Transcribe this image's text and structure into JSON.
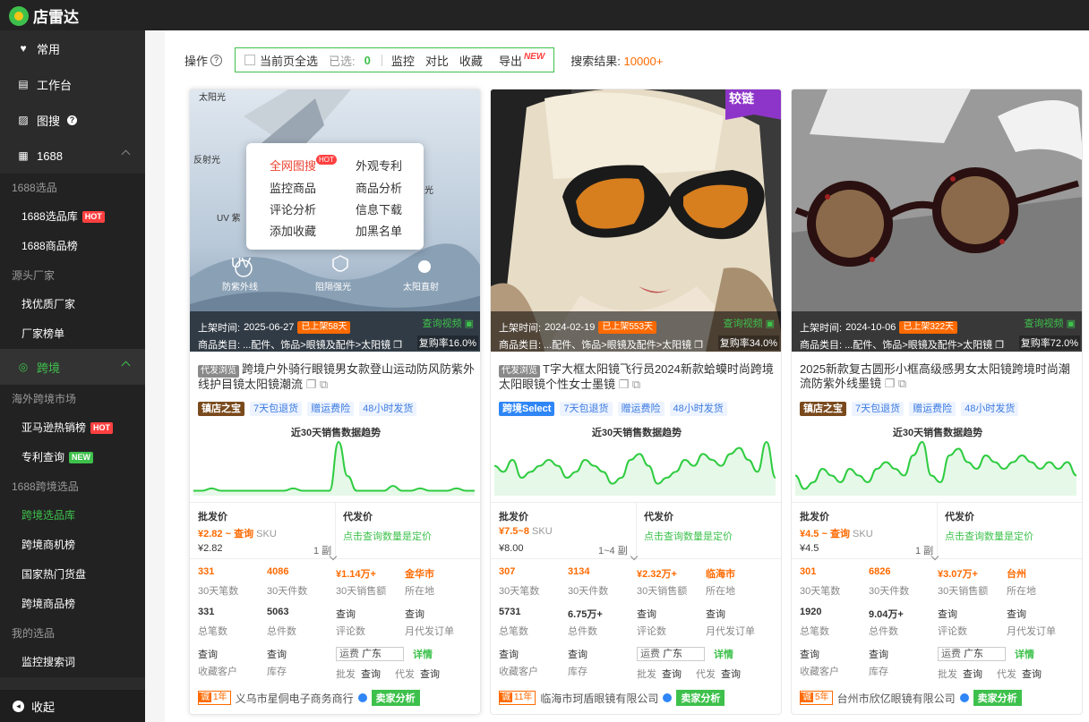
{
  "app": {
    "name": "店雷达"
  },
  "sidebar": {
    "items": [
      {
        "label": "常用"
      },
      {
        "label": "工作台"
      },
      {
        "label": "图搜"
      }
    ],
    "sec1688": "1688",
    "g1": "1688选品",
    "i1": "1688选品库",
    "i2": "1688商品榜",
    "g2": "源头厂家",
    "i3": "找优质厂家",
    "i4": "厂家榜单",
    "cross": "跨境",
    "g3": "海外跨境市场",
    "i5": "亚马逊热销榜",
    "i6": "专利查询",
    "g4": "1688跨境选品",
    "i7": "跨境选品库",
    "i8": "跨境商机榜",
    "i9": "国家热门货盘",
    "i10": "跨境商品榜",
    "g5": "我的选品",
    "i11": "监控搜索词",
    "collapse": "收起",
    "hot": "HOT",
    "new": "NEW"
  },
  "toolbar": {
    "op": "操作",
    "select_all": "当前页全选",
    "selected": "已选:",
    "count": "0",
    "monitor": "监控",
    "compare": "对比",
    "fav": "收藏",
    "export": "导出",
    "newtag": "NEW",
    "result_label": "搜索结果:",
    "result_value": "10000+"
  },
  "menu": {
    "a": "全网图搜",
    "hot": "HOT",
    "b": "外观专利",
    "c": "监控商品",
    "d": "商品分析",
    "e": "评论分析",
    "f": "信息下载",
    "g": "添加收藏",
    "h": "加黑名单"
  },
  "common": {
    "up_label": "上架时间:",
    "cat_label": "商品类目:",
    "cat_value": "...配件、饰品>眼镜及配件>太阳镜",
    "video": "查询视频",
    "trend": "近30天销售数据趋势",
    "wholesale": "批发价",
    "sku": "SKU",
    "dropship": "代发价",
    "dropship_link": "点击查询数量是定价",
    "l_30orders": "30天笔数",
    "l_30pieces": "30天件数",
    "l_30sales": "30天销售额",
    "l_loc": "所在地",
    "l_total_orders": "总笔数",
    "l_total_pieces": "总件数",
    "l_reviews": "评论数",
    "l_monthly": "月代发订单",
    "query": "查询",
    "l_fav_customers": "收藏客户",
    "l_stock": "库存",
    "freight": "运费",
    "freight_val": "广东",
    "detail": "详情",
    "pifa": "批发",
    "daifa": "代发",
    "seller_btn": "卖家分析",
    "daifa_tag": "代发浏览"
  },
  "cards": [
    {
      "date": "2025-06-27",
      "up_tag": "已上架58天",
      "repo": "复购率16.0%",
      "title": "跨境户外骑行眼镜男女款登山运动防风防紫外线护目镜太阳镜潮流",
      "has_dtag": true,
      "badge": "镇店之宝",
      "t1": "7天包退货",
      "t2": "赠运费险",
      "t3": "48小时发货",
      "price": "¥2.82 ~ 查询",
      "price2": "¥2.82",
      "moq": "1 副",
      "o30": "331",
      "p30": "4086",
      "s30": "¥1.14万+",
      "loc": "金华市",
      "to": "331",
      "tp": "5063",
      "years": "1年",
      "seller": "义乌市星侗电子商务商行",
      "img_labels": [
        "太阳光",
        "反射光",
        "UV 紫",
        "UV",
        "防紫外线",
        "阻隔强光",
        "太阳直射",
        "光"
      ]
    },
    {
      "date": "2024-02-19",
      "up_tag": "已上架553天",
      "repo": "复购率34.0%",
      "title": "T字大框太阳镜飞行员2024新款蛤蟆时尚跨境太阳眼镜个性女士墨镜",
      "has_dtag": true,
      "badge": "跨境Select",
      "t1": "7天包退货",
      "t2": "赠运费险",
      "t3": "48小时发货",
      "price": "¥7.5~8",
      "price2": "¥8.00",
      "moq": "1~4 副",
      "o30": "307",
      "p30": "3134",
      "s30": "¥2.32万+",
      "loc": "临海市",
      "to": "5731",
      "tp": "6.75万+",
      "years": "11年",
      "seller": "临海市珂盾眼镜有限公司",
      "corner": "较链"
    },
    {
      "date": "2024-10-06",
      "up_tag": "已上架322天",
      "repo": "复购率72.0%",
      "title": "2025新款复古圆形小框高级感男女太阳镜跨境时尚潮流防紫外线墨镜",
      "has_dtag": false,
      "badge": "镇店之宝",
      "t1": "7天包退货",
      "t2": "赠运费险",
      "t3": "48小时发货",
      "price": "¥4.5 ~ 查询",
      "price2": "¥4.5",
      "moq": "1 副",
      "o30": "301",
      "p30": "6826",
      "s30": "¥3.07万+",
      "loc": "台州",
      "to": "1920",
      "tp": "9.04万+",
      "years": "5年",
      "seller": "台州市欣亿眼镜有限公司"
    }
  ],
  "chart_data": [
    {
      "type": "area",
      "title": "近30天销售数据趋势",
      "values": [
        1,
        1,
        1.5,
        1,
        1,
        1,
        1,
        1,
        1,
        1,
        1,
        1.5,
        1,
        1,
        1,
        1,
        11,
        4,
        1,
        1,
        1,
        1,
        2,
        1,
        1,
        1.5,
        1,
        1,
        1,
        1.5,
        1,
        1
      ]
    },
    {
      "type": "area",
      "title": "近30天销售数据趋势",
      "values": [
        5,
        4,
        6,
        3,
        4,
        5,
        6,
        5,
        3,
        4,
        6,
        5,
        4,
        2,
        3,
        6,
        7,
        5,
        2,
        3,
        4,
        6,
        5,
        7,
        6,
        5,
        7,
        8,
        6,
        4,
        9,
        3
      ]
    },
    {
      "type": "area",
      "title": "近30天销售数据趋势",
      "values": [
        3,
        1,
        2,
        4,
        3,
        2,
        4,
        3,
        2,
        4,
        5,
        4,
        3,
        6,
        8,
        3,
        2,
        6,
        7,
        5,
        4,
        6,
        5,
        4,
        5,
        6,
        5,
        4,
        5,
        4,
        5,
        3
      ]
    }
  ]
}
